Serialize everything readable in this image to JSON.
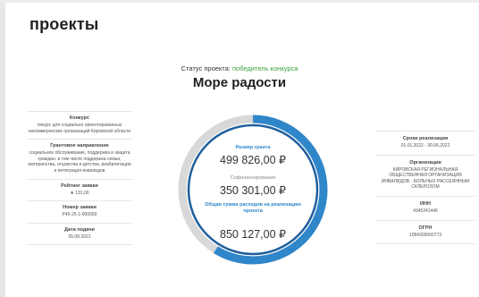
{
  "page": {
    "title": "проекты"
  },
  "status": {
    "label": "Статус проекта:",
    "value": "победитель конкурса",
    "value_color": "#3aa13a"
  },
  "project": {
    "name": "Море радости"
  },
  "left_info": [
    {
      "label": "Конкурс",
      "value": "онкурс для социально ориентированных некоммерческих организаций Кировской области"
    },
    {
      "label": "Грантовое направление",
      "value": "социальное обслуживание, поддержка и защита граждан, в том числе поддержка семьи, материнства, отцовства и детства, реабилитация и интеграция инвалидов"
    },
    {
      "label": "Рейтинг заявки",
      "value": "★ 131,00"
    },
    {
      "label": "Номер заявки",
      "value": "Р45-25-1-000050"
    },
    {
      "label": "Дата подачи",
      "value": "05.08.2021"
    }
  ],
  "right_info": [
    {
      "label": "Сроки реализации",
      "value": "01.01.2022 - 30.06.2022"
    },
    {
      "label": "Организация",
      "value": "КИРОВСКАЯ РЕГИОНАЛЬНАЯ ОБЩЕСТВЕННАЯ ОРГАНИЗАЦИЯ ИНВАЛИДОВ - БОЛЬНЫХ РАССЕЯННЫМ СКЛЕРОЗОМ"
    },
    {
      "label": "ИНН",
      "value": "4345241445"
    },
    {
      "label": "ОГРН",
      "value": "1084300000773"
    }
  ],
  "gauge": {
    "grant_label": "Размер гранта",
    "grant_amount": "499 826,00 ₽",
    "cofinance_label": "Софинансирование",
    "cofinance_amount": "350 301,00 ₽",
    "total_label": "Общая сумма расходов на реализацию проекта",
    "total_amount": "850 127,00 ₽",
    "grant_fraction": 0.588,
    "colors": {
      "grant": "#2f86c9",
      "track": "#d8d8d8",
      "inner": "#1f5f9e"
    }
  }
}
